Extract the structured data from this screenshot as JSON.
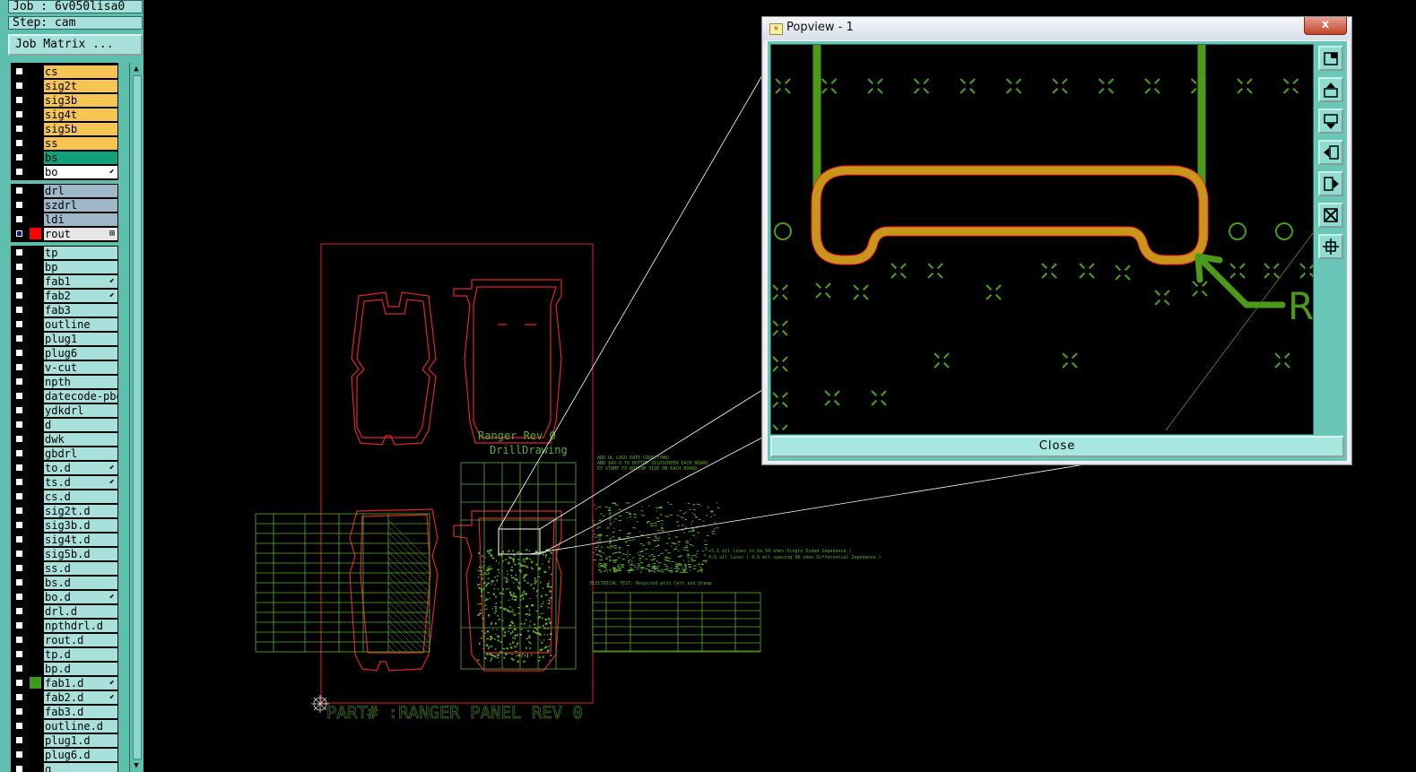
{
  "job": {
    "job_line": "Job : 6v050lisa0",
    "step_line": "Step: cam",
    "matrix_button": "Job Matrix ..."
  },
  "layers": [
    {
      "name": "cs",
      "color": "#f5c452",
      "group": 1
    },
    {
      "name": "sig2t",
      "color": "#f5c452",
      "group": 1
    },
    {
      "name": "sig3b",
      "color": "#f5c452",
      "group": 1
    },
    {
      "name": "sig4t",
      "color": "#f5c452",
      "group": 1
    },
    {
      "name": "sig5b",
      "color": "#f5c452",
      "group": 1
    },
    {
      "name": "ss",
      "color": "#f5c452",
      "group": 1
    },
    {
      "name": "bs",
      "color": "#10a07a",
      "group": 1
    },
    {
      "name": "bo",
      "color": "#ffffff",
      "group": 1,
      "flag": "⬋"
    },
    {
      "name": "drl",
      "color": "#9fb8c8",
      "group": 2
    },
    {
      "name": "szdrl",
      "color": "#9fb8c8",
      "group": 2
    },
    {
      "name": "ldi",
      "color": "#9fb8c8",
      "group": 2
    },
    {
      "name": "rout",
      "color": "#e6e6e6",
      "group": 2,
      "flag": "⊞",
      "checked": true,
      "mark": "#ff0000"
    },
    {
      "name": "tp",
      "color": "#a8e0dc",
      "group": 3
    },
    {
      "name": "bp",
      "color": "#a8e0dc",
      "group": 3
    },
    {
      "name": "fab1",
      "color": "#a8e0dc",
      "group": 3,
      "flag": "⬋"
    },
    {
      "name": "fab2",
      "color": "#a8e0dc",
      "group": 3,
      "flag": "⬋"
    },
    {
      "name": "fab3",
      "color": "#a8e0dc",
      "group": 3
    },
    {
      "name": "outline",
      "color": "#a8e0dc",
      "group": 3
    },
    {
      "name": "plug1",
      "color": "#a8e0dc",
      "group": 3
    },
    {
      "name": "plug6",
      "color": "#a8e0dc",
      "group": 3
    },
    {
      "name": "v-cut",
      "color": "#a8e0dc",
      "group": 3
    },
    {
      "name": "npth",
      "color": "#a8e0dc",
      "group": 3
    },
    {
      "name": "datecode-pbe",
      "color": "#a8e0dc",
      "group": 3
    },
    {
      "name": "ydkdrl",
      "color": "#a8e0dc",
      "group": 3
    },
    {
      "name": "d",
      "color": "#a8e0dc",
      "group": 3
    },
    {
      "name": "dwk",
      "color": "#a8e0dc",
      "group": 3
    },
    {
      "name": "gbdrl",
      "color": "#a8e0dc",
      "group": 3
    },
    {
      "name": "to.d",
      "color": "#a8e0dc",
      "group": 3,
      "flag": "⬋"
    },
    {
      "name": "ts.d",
      "color": "#a8e0dc",
      "group": 3,
      "flag": "⬋"
    },
    {
      "name": "cs.d",
      "color": "#a8e0dc",
      "group": 3
    },
    {
      "name": "sig2t.d",
      "color": "#a8e0dc",
      "group": 3
    },
    {
      "name": "sig3b.d",
      "color": "#a8e0dc",
      "group": 3
    },
    {
      "name": "sig4t.d",
      "color": "#a8e0dc",
      "group": 3
    },
    {
      "name": "sig5b.d",
      "color": "#a8e0dc",
      "group": 3
    },
    {
      "name": "ss.d",
      "color": "#a8e0dc",
      "group": 3
    },
    {
      "name": "bs.d",
      "color": "#a8e0dc",
      "group": 3
    },
    {
      "name": "bo.d",
      "color": "#a8e0dc",
      "group": 3,
      "flag": "⬋"
    },
    {
      "name": "drl.d",
      "color": "#a8e0dc",
      "group": 3
    },
    {
      "name": "npthdrl.d",
      "color": "#a8e0dc",
      "group": 3
    },
    {
      "name": "rout.d",
      "color": "#a8e0dc",
      "group": 3
    },
    {
      "name": "tp.d",
      "color": "#a8e0dc",
      "group": 3
    },
    {
      "name": "bp.d",
      "color": "#a8e0dc",
      "group": 3
    },
    {
      "name": "fab1.d",
      "color": "#a8e0dc",
      "group": 3,
      "flag": "⬋",
      "mark": "#3c9a1e"
    },
    {
      "name": "fab2.d",
      "color": "#a8e0dc",
      "group": 3,
      "flag": "⬋"
    },
    {
      "name": "fab3.d",
      "color": "#a8e0dc",
      "group": 3
    },
    {
      "name": "outline.d",
      "color": "#a8e0dc",
      "group": 3
    },
    {
      "name": "plug1.d",
      "color": "#a8e0dc",
      "group": 3
    },
    {
      "name": "plug6.d",
      "color": "#a8e0dc",
      "group": 3
    },
    {
      "name": "q",
      "color": "#a8e0dc",
      "group": 3
    }
  ],
  "canvas": {
    "board_text_1": "Ranger Rev 0",
    "board_text_2": "DrillDrawing",
    "part_label": "PART# :RANGER PANEL REV 0",
    "note_line_1": "ADD UL LOGO DATE CODE(YYWW)",
    "note_line_2": "AND 94V-0 TO BOTTOM SILKSCREEN EACH BOARD",
    "note_line_3": "ET STAMP TO BOTTOM SIDE ON EACH BOARD",
    "imp_line_1": "+5.1 all lines to be 50 ohms Single Ended Impedance.)",
    "imp_line_2": "4.5 all lines ( 4.5 mil spacing 90 ohms Differential Impedance.)",
    "imp_line_3": "ELECTRICAL TEST: Required with Cert and Stamp",
    "colors": {
      "rout": "#e0242a",
      "fab": "#5cae2a",
      "pad": "#3f8f22"
    }
  },
  "popview": {
    "title": "Popview - 1",
    "close_x": "x",
    "close_button": "Close",
    "pointer_letter": "R",
    "colors": {
      "trace": "#4c9a1a",
      "rout_outline": "#c8961a",
      "rout_edge": "#ff2020",
      "pad": "#4c9a1a"
    },
    "tools": [
      "zoom-fit-icon",
      "pan-up-icon",
      "pan-down-icon",
      "pan-left-icon",
      "pan-right-icon",
      "zoom-home-icon",
      "zoom-in-icon"
    ]
  }
}
